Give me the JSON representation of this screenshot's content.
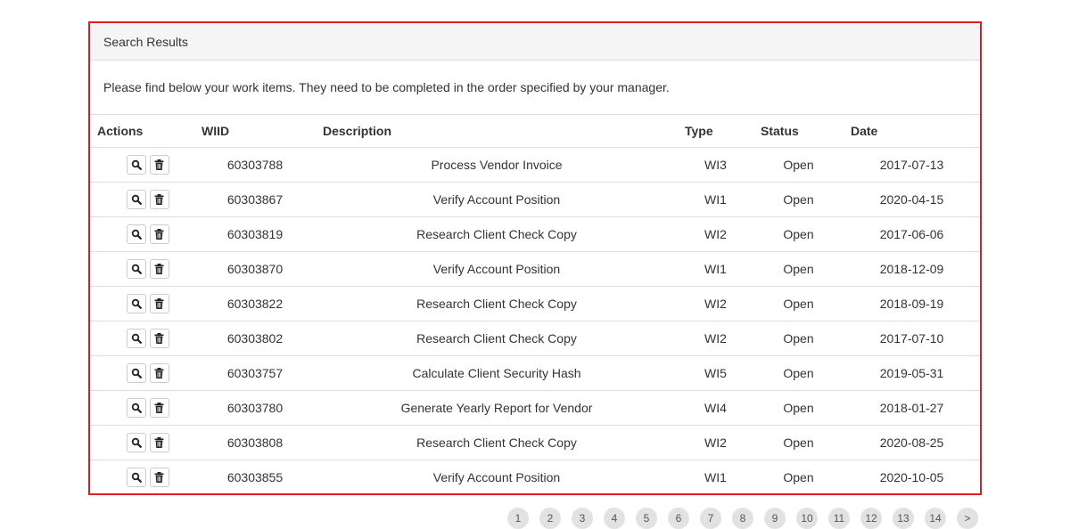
{
  "panel": {
    "heading": "Search Results",
    "intro": "Please find below your work items. They need to be completed in the order specified by your manager."
  },
  "table": {
    "headers": [
      "Actions",
      "WIID",
      "Description",
      "Type",
      "Status",
      "Date"
    ],
    "rows": [
      {
        "wiid": "60303788",
        "description": "Process Vendor Invoice",
        "type": "WI3",
        "status": "Open",
        "date": "2017-07-13"
      },
      {
        "wiid": "60303867",
        "description": "Verify Account Position",
        "type": "WI1",
        "status": "Open",
        "date": "2020-04-15"
      },
      {
        "wiid": "60303819",
        "description": "Research Client Check Copy",
        "type": "WI2",
        "status": "Open",
        "date": "2017-06-06"
      },
      {
        "wiid": "60303870",
        "description": "Verify Account Position",
        "type": "WI1",
        "status": "Open",
        "date": "2018-12-09"
      },
      {
        "wiid": "60303822",
        "description": "Research Client Check Copy",
        "type": "WI2",
        "status": "Open",
        "date": "2018-09-19"
      },
      {
        "wiid": "60303802",
        "description": "Research Client Check Copy",
        "type": "WI2",
        "status": "Open",
        "date": "2017-07-10"
      },
      {
        "wiid": "60303757",
        "description": "Calculate Client Security Hash",
        "type": "WI5",
        "status": "Open",
        "date": "2019-05-31"
      },
      {
        "wiid": "60303780",
        "description": "Generate Yearly Report for Vendor",
        "type": "WI4",
        "status": "Open",
        "date": "2018-01-27"
      },
      {
        "wiid": "60303808",
        "description": "Research Client Check Copy",
        "type": "WI2",
        "status": "Open",
        "date": "2020-08-25"
      },
      {
        "wiid": "60303855",
        "description": "Verify Account Position",
        "type": "WI1",
        "status": "Open",
        "date": "2020-10-05"
      }
    ],
    "row_actions": [
      "search-icon",
      "trash-icon"
    ]
  },
  "pagination": {
    "pages": [
      "1",
      "2",
      "3",
      "4",
      "5",
      "6",
      "7",
      "8",
      "9",
      "10",
      "11",
      "12",
      "13",
      "14"
    ],
    "next": ">"
  },
  "colors": {
    "panel_border": "#d9201f",
    "heading_bg": "#f5f5f5"
  }
}
